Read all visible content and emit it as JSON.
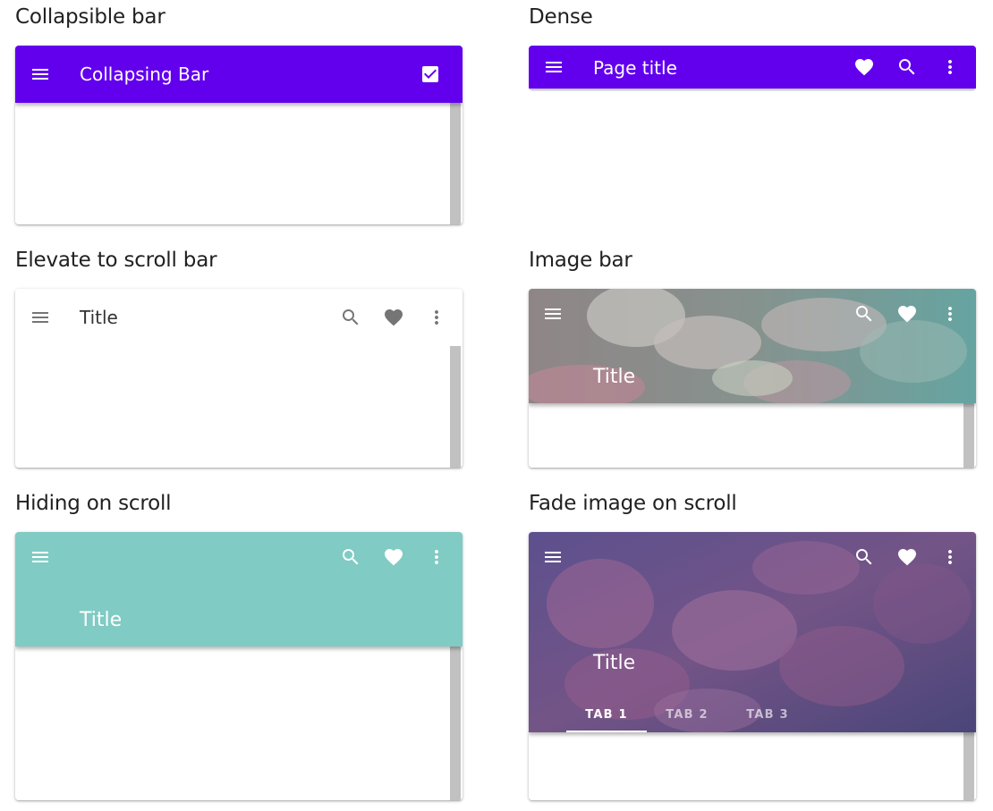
{
  "sections": {
    "collapsible": {
      "heading": "Collapsible bar",
      "bar_title": "Collapsing Bar",
      "bar_color": "#6200ee",
      "icons": [
        "menu-icon",
        "checkbox-checked-icon"
      ]
    },
    "dense": {
      "heading": "Dense",
      "bar_title": "Page title",
      "bar_color": "#6200ee",
      "icons": [
        "menu-icon",
        "heart-icon",
        "search-icon",
        "more-vert-icon"
      ]
    },
    "elevate": {
      "heading": "Elevate to scroll bar",
      "bar_title": "Title",
      "bar_color": "#ffffff",
      "icon_color": "#757575",
      "icons": [
        "menu-icon",
        "search-icon",
        "heart-icon",
        "more-vert-icon"
      ]
    },
    "image": {
      "heading": "Image bar",
      "bar_title": "Title",
      "icons": [
        "menu-icon",
        "search-icon",
        "heart-icon",
        "more-vert-icon"
      ]
    },
    "hiding": {
      "heading": "Hiding on scroll",
      "bar_title": "Title",
      "bar_color": "#80cbc4",
      "icons": [
        "menu-icon",
        "search-icon",
        "heart-icon",
        "more-vert-icon"
      ]
    },
    "fade": {
      "heading": "Fade image on scroll",
      "bar_title": "Title",
      "icons": [
        "menu-icon",
        "search-icon",
        "heart-icon",
        "more-vert-icon"
      ],
      "tabs": [
        "TAB 1",
        "TAB 2",
        "TAB 3"
      ],
      "active_tab": "TAB 1"
    }
  },
  "colors": {
    "primary": "#6200ee",
    "teal": "#80cbc4",
    "scrollbar": "#c1c1c1"
  }
}
